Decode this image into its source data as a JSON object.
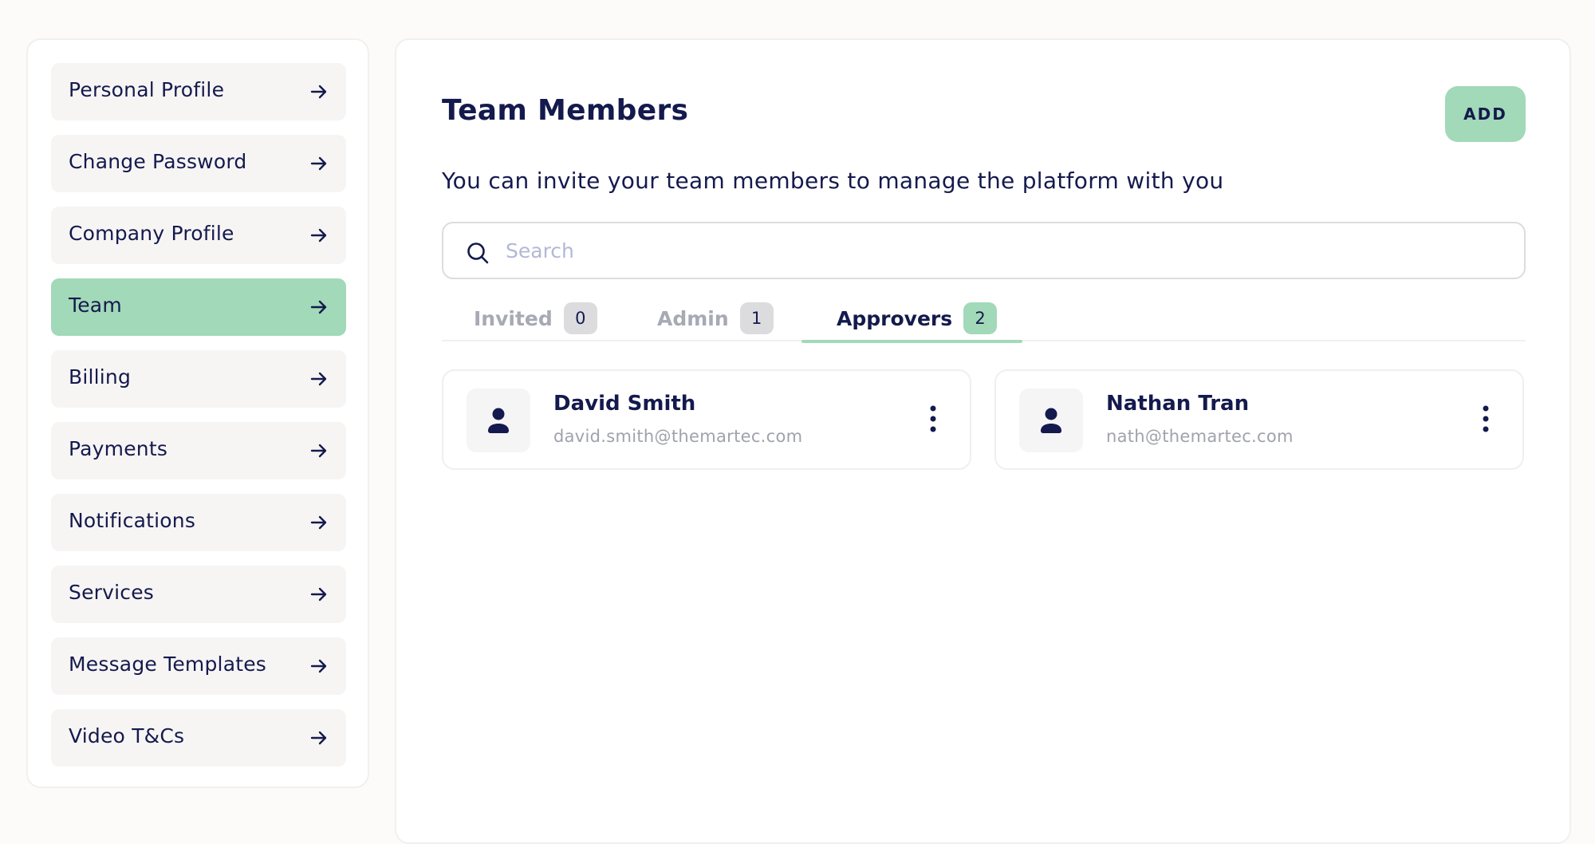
{
  "sidebar": {
    "items": [
      {
        "label": "Personal Profile",
        "active": false
      },
      {
        "label": "Change Password",
        "active": false
      },
      {
        "label": "Company Profile",
        "active": false
      },
      {
        "label": "Team",
        "active": true
      },
      {
        "label": "Billing",
        "active": false
      },
      {
        "label": "Payments",
        "active": false
      },
      {
        "label": "Notifications",
        "active": false
      },
      {
        "label": "Services",
        "active": false
      },
      {
        "label": "Message Templates",
        "active": false
      },
      {
        "label": "Video T&Cs",
        "active": false
      }
    ]
  },
  "main": {
    "title": "Team Members",
    "add_label": "ADD",
    "subtitle": "You can invite your team members to manage the platform with you",
    "search": {
      "placeholder": "Search",
      "value": ""
    },
    "tabs": [
      {
        "label": "Invited",
        "count": "0",
        "active": false
      },
      {
        "label": "Admin",
        "count": "1",
        "active": false
      },
      {
        "label": "Approvers",
        "count": "2",
        "active": true
      }
    ],
    "members": [
      {
        "name": "David Smith",
        "email": "david.smith@themartec.com"
      },
      {
        "name": "Nathan Tran",
        "email": "nath@themartec.com"
      }
    ]
  },
  "colors": {
    "accent": "#a2d9b8",
    "text": "#141a4d",
    "muted": "#a7a9b3",
    "page_background": "#fcfbfa"
  },
  "icons": {
    "nav_arrow": "arrow-right-icon",
    "search": "search-icon",
    "avatar": "user-icon",
    "menu": "kebab-menu-icon"
  }
}
